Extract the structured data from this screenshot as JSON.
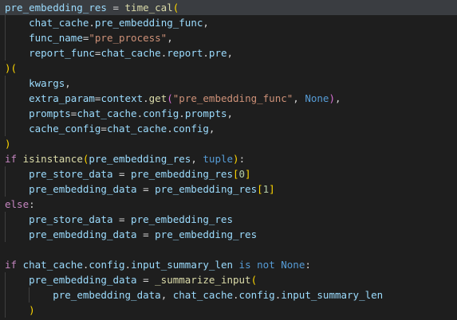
{
  "editor": {
    "theme_colors": {
      "background": "#1e1e1e",
      "variable": "#9cdcfe",
      "function": "#dcdcaa",
      "string": "#ce9178",
      "keyword": "#c586c0",
      "constant": "#569cd6",
      "number": "#b5cea8",
      "bracket_1": "#ffd700",
      "bracket_2": "#da70d6",
      "bracket_3": "#179fff"
    },
    "lines": [
      {
        "highlight": true,
        "tokens": [
          {
            "t": "pre_embedding_res",
            "c": "var"
          },
          {
            "t": " = ",
            "c": "plain"
          },
          {
            "t": "time_cal",
            "c": "fn"
          },
          {
            "t": "(",
            "c": "p1"
          }
        ]
      },
      {
        "tokens": [
          {
            "t": "    ",
            "c": "plain"
          },
          {
            "t": "chat_cache",
            "c": "var"
          },
          {
            "t": ".",
            "c": "plain"
          },
          {
            "t": "pre_embedding_func",
            "c": "var"
          },
          {
            "t": ",",
            "c": "plain"
          }
        ]
      },
      {
        "tokens": [
          {
            "t": "    ",
            "c": "plain"
          },
          {
            "t": "func_name",
            "c": "var"
          },
          {
            "t": "=",
            "c": "plain"
          },
          {
            "t": "\"pre_process\"",
            "c": "str"
          },
          {
            "t": ",",
            "c": "plain"
          }
        ]
      },
      {
        "tokens": [
          {
            "t": "    ",
            "c": "plain"
          },
          {
            "t": "report_func",
            "c": "var"
          },
          {
            "t": "=",
            "c": "plain"
          },
          {
            "t": "chat_cache",
            "c": "var"
          },
          {
            "t": ".",
            "c": "plain"
          },
          {
            "t": "report",
            "c": "var"
          },
          {
            "t": ".",
            "c": "plain"
          },
          {
            "t": "pre",
            "c": "var"
          },
          {
            "t": ",",
            "c": "plain"
          }
        ]
      },
      {
        "tokens": [
          {
            "t": ")",
            "c": "p1"
          },
          {
            "t": "(",
            "c": "p1"
          }
        ]
      },
      {
        "tokens": [
          {
            "t": "    ",
            "c": "plain"
          },
          {
            "t": "kwargs",
            "c": "var"
          },
          {
            "t": ",",
            "c": "plain"
          }
        ]
      },
      {
        "tokens": [
          {
            "t": "    ",
            "c": "plain"
          },
          {
            "t": "extra_param",
            "c": "var"
          },
          {
            "t": "=",
            "c": "plain"
          },
          {
            "t": "context",
            "c": "var"
          },
          {
            "t": ".",
            "c": "plain"
          },
          {
            "t": "get",
            "c": "fn"
          },
          {
            "t": "(",
            "c": "p2"
          },
          {
            "t": "\"pre_embedding_func\"",
            "c": "str"
          },
          {
            "t": ", ",
            "c": "plain"
          },
          {
            "t": "None",
            "c": "const"
          },
          {
            "t": ")",
            "c": "p2"
          },
          {
            "t": ",",
            "c": "plain"
          }
        ]
      },
      {
        "tokens": [
          {
            "t": "    ",
            "c": "plain"
          },
          {
            "t": "prompts",
            "c": "var"
          },
          {
            "t": "=",
            "c": "plain"
          },
          {
            "t": "chat_cache",
            "c": "var"
          },
          {
            "t": ".",
            "c": "plain"
          },
          {
            "t": "config",
            "c": "var"
          },
          {
            "t": ".",
            "c": "plain"
          },
          {
            "t": "prompts",
            "c": "var"
          },
          {
            "t": ",",
            "c": "plain"
          }
        ]
      },
      {
        "tokens": [
          {
            "t": "    ",
            "c": "plain"
          },
          {
            "t": "cache_config",
            "c": "var"
          },
          {
            "t": "=",
            "c": "plain"
          },
          {
            "t": "chat_cache",
            "c": "var"
          },
          {
            "t": ".",
            "c": "plain"
          },
          {
            "t": "config",
            "c": "var"
          },
          {
            "t": ",",
            "c": "plain"
          }
        ]
      },
      {
        "tokens": [
          {
            "t": ")",
            "c": "p1"
          }
        ]
      },
      {
        "tokens": [
          {
            "t": "if",
            "c": "kw"
          },
          {
            "t": " ",
            "c": "plain"
          },
          {
            "t": "isinstance",
            "c": "fn"
          },
          {
            "t": "(",
            "c": "p1"
          },
          {
            "t": "pre_embedding_res",
            "c": "var"
          },
          {
            "t": ", ",
            "c": "plain"
          },
          {
            "t": "tuple",
            "c": "const"
          },
          {
            "t": ")",
            "c": "p1"
          },
          {
            "t": ":",
            "c": "plain"
          }
        ]
      },
      {
        "tokens": [
          {
            "t": "    ",
            "c": "plain"
          },
          {
            "t": "pre_store_data",
            "c": "var"
          },
          {
            "t": " = ",
            "c": "plain"
          },
          {
            "t": "pre_embedding_res",
            "c": "var"
          },
          {
            "t": "[",
            "c": "p1"
          },
          {
            "t": "0",
            "c": "num"
          },
          {
            "t": "]",
            "c": "p1"
          }
        ]
      },
      {
        "tokens": [
          {
            "t": "    ",
            "c": "plain"
          },
          {
            "t": "pre_embedding_data",
            "c": "var"
          },
          {
            "t": " = ",
            "c": "plain"
          },
          {
            "t": "pre_embedding_res",
            "c": "var"
          },
          {
            "t": "[",
            "c": "p1"
          },
          {
            "t": "1",
            "c": "num"
          },
          {
            "t": "]",
            "c": "p1"
          }
        ]
      },
      {
        "tokens": [
          {
            "t": "else",
            "c": "kw"
          },
          {
            "t": ":",
            "c": "plain"
          }
        ]
      },
      {
        "tokens": [
          {
            "t": "    ",
            "c": "plain"
          },
          {
            "t": "pre_store_data",
            "c": "var"
          },
          {
            "t": " = ",
            "c": "plain"
          },
          {
            "t": "pre_embedding_res",
            "c": "var"
          }
        ]
      },
      {
        "tokens": [
          {
            "t": "    ",
            "c": "plain"
          },
          {
            "t": "pre_embedding_data",
            "c": "var"
          },
          {
            "t": " = ",
            "c": "plain"
          },
          {
            "t": "pre_embedding_res",
            "c": "var"
          }
        ]
      },
      {
        "tokens": []
      },
      {
        "tokens": [
          {
            "t": "if",
            "c": "kw"
          },
          {
            "t": " ",
            "c": "plain"
          },
          {
            "t": "chat_cache",
            "c": "var"
          },
          {
            "t": ".",
            "c": "plain"
          },
          {
            "t": "config",
            "c": "var"
          },
          {
            "t": ".",
            "c": "plain"
          },
          {
            "t": "input_summary_len",
            "c": "var"
          },
          {
            "t": " ",
            "c": "plain"
          },
          {
            "t": "is",
            "c": "const"
          },
          {
            "t": " ",
            "c": "plain"
          },
          {
            "t": "not",
            "c": "const"
          },
          {
            "t": " ",
            "c": "plain"
          },
          {
            "t": "None",
            "c": "const"
          },
          {
            "t": ":",
            "c": "plain"
          }
        ]
      },
      {
        "tokens": [
          {
            "t": "    ",
            "c": "plain"
          },
          {
            "t": "pre_embedding_data",
            "c": "var"
          },
          {
            "t": " = ",
            "c": "plain"
          },
          {
            "t": "_summarize_input",
            "c": "fn"
          },
          {
            "t": "(",
            "c": "p1"
          }
        ]
      },
      {
        "tokens": [
          {
            "t": "        ",
            "c": "plain"
          },
          {
            "t": "pre_embedding_data",
            "c": "var"
          },
          {
            "t": ", ",
            "c": "plain"
          },
          {
            "t": "chat_cache",
            "c": "var"
          },
          {
            "t": ".",
            "c": "plain"
          },
          {
            "t": "config",
            "c": "var"
          },
          {
            "t": ".",
            "c": "plain"
          },
          {
            "t": "input_summary_len",
            "c": "var"
          }
        ]
      },
      {
        "tokens": [
          {
            "t": "    ",
            "c": "plain"
          },
          {
            "t": ")",
            "c": "p1"
          }
        ]
      }
    ]
  }
}
